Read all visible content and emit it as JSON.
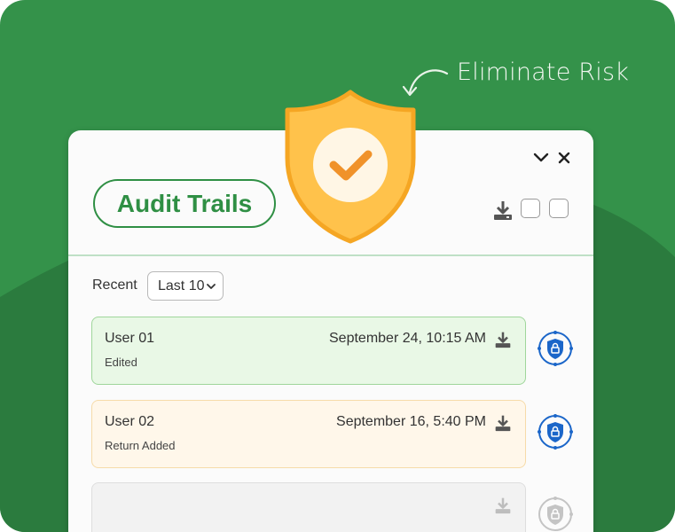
{
  "annotation": "Eliminate Risk",
  "title": "Audit Trails",
  "filter": {
    "label": "Recent",
    "selected": "Last 10"
  },
  "entries": [
    {
      "user": "User 01",
      "time": "September 24, 10:15 AM",
      "action": "Edited",
      "bg": "#e9f8e6",
      "border": "#9fd69b"
    },
    {
      "user": "User 02",
      "time": "September 16, 5:40 PM",
      "action": "Return Added",
      "bg": "#fff7ea",
      "border": "#f6dba9"
    },
    {
      "user": "",
      "time": "",
      "action": "",
      "bg": "#f2f2f2",
      "border": "#dedede"
    }
  ],
  "colors": {
    "brand_green": "#34924a",
    "dark_green": "#2b7b3e",
    "shield": "#ffc24b",
    "shield_border": "#f5a623",
    "check": "#f0922a",
    "lock_blue": "#1b66c9"
  },
  "icons": [
    "chevron-down-icon",
    "close-icon",
    "download-icon",
    "shield-check-icon",
    "lock-shield-icon",
    "curved-arrow-icon"
  ]
}
